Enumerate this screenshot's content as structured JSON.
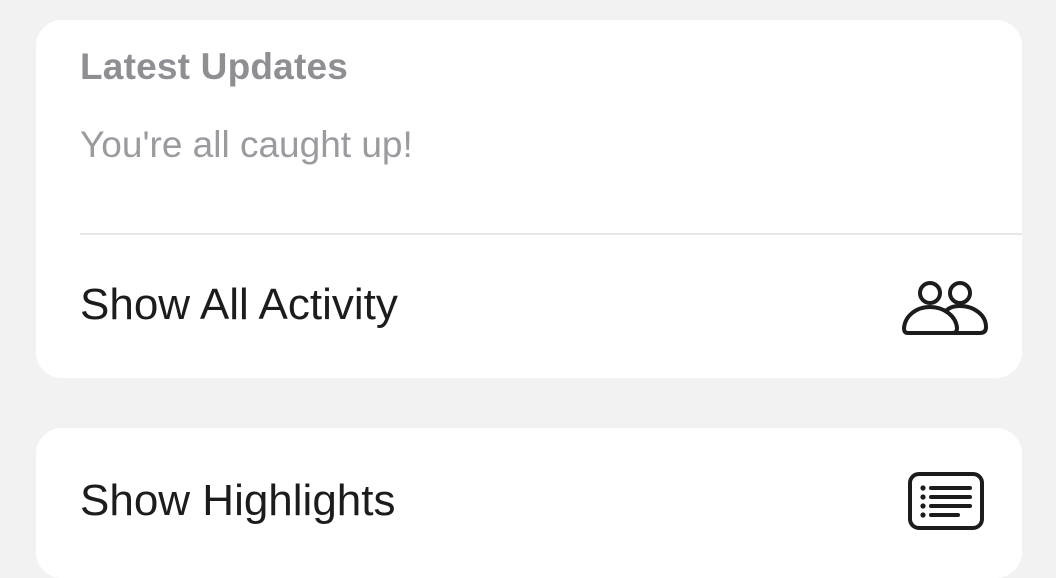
{
  "updates": {
    "title": "Latest Updates",
    "status_text": "You're all caught up!"
  },
  "rows": {
    "activity": {
      "label": "Show All Activity",
      "icon": "people-icon"
    },
    "highlights": {
      "label": "Show Highlights",
      "icon": "list-icon"
    }
  },
  "colors": {
    "background": "#f2f2f2",
    "card": "#ffffff",
    "secondary_text": "#8e8e93",
    "primary_text": "#1c1c1e"
  }
}
